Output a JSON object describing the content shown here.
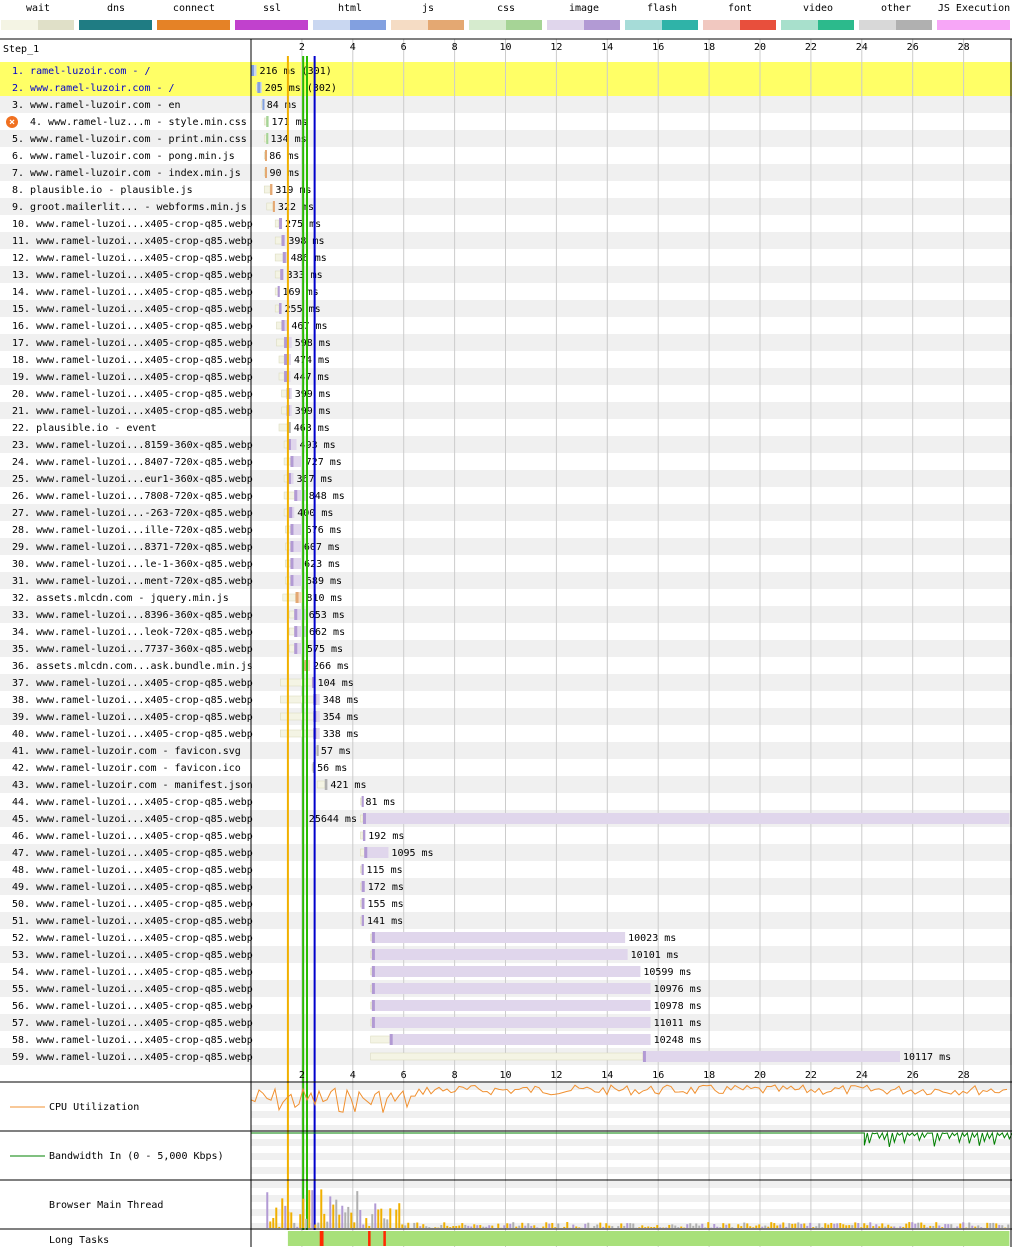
{
  "legend": [
    {
      "label": "wait",
      "light": "#f4f4e4",
      "dark": "#e0e0c8"
    },
    {
      "label": "dns",
      "light": "#1f7c83",
      "dark": "#1f7c83"
    },
    {
      "label": "connect",
      "light": "#e58226",
      "dark": "#e58226"
    },
    {
      "label": "ssl",
      "light": "#c141cd",
      "dark": "#c141cd"
    },
    {
      "label": "html",
      "light": "#c9d7f1",
      "dark": "#82a0e0"
    },
    {
      "label": "js",
      "light": "#f5dcc4",
      "dark": "#e4a872"
    },
    {
      "label": "css",
      "light": "#d6ebce",
      "dark": "#a6d496"
    },
    {
      "label": "image",
      "light": "#e0d6ec",
      "dark": "#b29ad4"
    },
    {
      "label": "flash",
      "light": "#a6dcd8",
      "dark": "#2fb3a8"
    },
    {
      "label": "font",
      "light": "#f1c8c0",
      "dark": "#e84f3c"
    },
    {
      "label": "video",
      "light": "#a8e0cc",
      "dark": "#2cba8c"
    },
    {
      "label": "other",
      "light": "#d8d8d8",
      "dark": "#b0b0b0"
    },
    {
      "label": "JS Execution",
      "light": "#f7a6f7",
      "dark": "#f7a6f7"
    }
  ],
  "step_label": "Step_1",
  "colors": {
    "highlight": "#ffff66",
    "row_alt": "#f0f0f0",
    "grid": "#cccccc",
    "start_render": "#28bc00",
    "first_paint": "#f0b000",
    "dom_content": "#0000cc",
    "cpu": "#f09030",
    "bandwidth": "#008000",
    "long_task": "#a8e07a",
    "long_task_red": "#ff2a00"
  },
  "chart_data": {
    "type": "waterfall",
    "x_unit": "s",
    "xlim": [
      0,
      29.8
    ],
    "tick_labels": [
      "2",
      "4",
      "6",
      "8",
      "10",
      "12",
      "14",
      "16",
      "18",
      "20",
      "22",
      "24",
      "26",
      "28"
    ],
    "tick_values": [
      2,
      4,
      6,
      8,
      10,
      12,
      14,
      16,
      18,
      20,
      22,
      24,
      26,
      28
    ],
    "markers": [
      {
        "name": "first_paint",
        "x": 1.45
      },
      {
        "name": "start_render_a",
        "x": 2.05
      },
      {
        "name": "start_render_b",
        "x": 2.2
      },
      {
        "name": "dom_content",
        "x": 2.5
      }
    ],
    "requests": [
      {
        "n": "1",
        "label": "ramel-luzoir.com - /",
        "start": 0.0,
        "wait": 0.0,
        "end": 0.216,
        "type": "html",
        "timing": "216 ms (301)",
        "highlight": true,
        "error": false
      },
      {
        "n": "2",
        "label": "www.ramel-luzoir.com - /",
        "start": 0.2,
        "wait": 0.25,
        "end": 0.42,
        "type": "html",
        "timing": "205 ms (302)",
        "highlight": true,
        "error": false
      },
      {
        "n": "3",
        "label": "www.ramel-luzoir.com - en",
        "start": 0.42,
        "wait": 0.45,
        "end": 0.5,
        "type": "html",
        "timing": "84 ms",
        "highlight": false,
        "error": false
      },
      {
        "n": "4",
        "label": "www.ramel-luz...m - style.min.css",
        "start": 0.52,
        "wait": 0.6,
        "end": 0.69,
        "type": "css",
        "timing": "171 ms",
        "highlight": false,
        "error": true
      },
      {
        "n": "5",
        "label": "www.ramel-luzoir.com - print.min.css",
        "start": 0.52,
        "wait": 0.6,
        "end": 0.65,
        "type": "css",
        "timing": "134 ms",
        "highlight": false,
        "error": false
      },
      {
        "n": "6",
        "label": "www.ramel-luzoir.com - pong.min.js",
        "start": 0.52,
        "wait": 0.55,
        "end": 0.6,
        "type": "js",
        "timing": "86 ms",
        "highlight": false,
        "error": false
      },
      {
        "n": "7",
        "label": "www.ramel-luzoir.com - index.min.js",
        "start": 0.52,
        "wait": 0.55,
        "end": 0.61,
        "type": "js",
        "timing": "90 ms",
        "highlight": false,
        "error": false
      },
      {
        "n": "8",
        "label": "plausible.io - plausible.js",
        "start": 0.52,
        "wait": 0.75,
        "end": 0.84,
        "type": "js",
        "timing": "319 ms",
        "highlight": false,
        "error": false
      },
      {
        "n": "9",
        "label": "groot.mailerlit... - webforms.min.js",
        "start": 0.62,
        "wait": 0.86,
        "end": 0.94,
        "type": "js",
        "timing": "322 ms",
        "highlight": false,
        "error": false
      },
      {
        "n": "10",
        "label": "www.ramel-luzoi...x405-crop-q85.webp",
        "start": 0.95,
        "wait": 1.1,
        "end": 1.22,
        "type": "image",
        "timing": "275 ms",
        "highlight": false,
        "error": false
      },
      {
        "n": "11",
        "label": "www.ramel-luzoi...x405-crop-q85.webp",
        "start": 0.95,
        "wait": 1.2,
        "end": 1.35,
        "type": "image",
        "timing": "398 ms",
        "highlight": false,
        "error": false
      },
      {
        "n": "12",
        "label": "www.ramel-luzoi...x405-crop-q85.webp",
        "start": 0.95,
        "wait": 1.25,
        "end": 1.44,
        "type": "image",
        "timing": "486 ms",
        "highlight": false,
        "error": false
      },
      {
        "n": "13",
        "label": "www.ramel-luzoi...x405-crop-q85.webp",
        "start": 0.95,
        "wait": 1.15,
        "end": 1.28,
        "type": "image",
        "timing": "333 ms",
        "highlight": false,
        "error": false
      },
      {
        "n": "14",
        "label": "www.ramel-luzoi...x405-crop-q85.webp",
        "start": 0.95,
        "wait": 1.05,
        "end": 1.12,
        "type": "image",
        "timing": "169 ms",
        "highlight": false,
        "error": false
      },
      {
        "n": "15",
        "label": "www.ramel-luzoi...x405-crop-q85.webp",
        "start": 0.95,
        "wait": 1.1,
        "end": 1.2,
        "type": "image",
        "timing": "255 ms",
        "highlight": false,
        "error": false
      },
      {
        "n": "16",
        "label": "www.ramel-luzoi...x405-crop-q85.webp",
        "start": 1.0,
        "wait": 1.2,
        "end": 1.47,
        "type": "image",
        "timing": "467 ms",
        "highlight": false,
        "error": false
      },
      {
        "n": "17",
        "label": "www.ramel-luzoi...x405-crop-q85.webp",
        "start": 1.0,
        "wait": 1.3,
        "end": 1.6,
        "type": "image",
        "timing": "598 ms",
        "highlight": false,
        "error": false
      },
      {
        "n": "18",
        "label": "www.ramel-luzoi...x405-crop-q85.webp",
        "start": 1.1,
        "wait": 1.3,
        "end": 1.57,
        "type": "image",
        "timing": "474 ms",
        "highlight": false,
        "error": false
      },
      {
        "n": "19",
        "label": "www.ramel-luzoi...x405-crop-q85.webp",
        "start": 1.1,
        "wait": 1.3,
        "end": 1.55,
        "type": "image",
        "timing": "447 ms",
        "highlight": false,
        "error": false
      },
      {
        "n": "20",
        "label": "www.ramel-luzoi...x405-crop-q85.webp",
        "start": 1.2,
        "wait": 1.4,
        "end": 1.6,
        "type": "image",
        "timing": "399 ms",
        "highlight": false,
        "error": false
      },
      {
        "n": "21",
        "label": "www.ramel-luzoi...x405-crop-q85.webp",
        "start": 1.2,
        "wait": 1.4,
        "end": 1.6,
        "type": "image",
        "timing": "399 ms",
        "highlight": false,
        "error": false
      },
      {
        "n": "22",
        "label": "plausible.io - event",
        "start": 1.1,
        "wait": 1.45,
        "end": 1.56,
        "type": "other",
        "timing": "463 ms",
        "highlight": false,
        "error": false
      },
      {
        "n": "23",
        "label": "www.ramel-luzoi...8159-360x-q85.webp",
        "start": 1.3,
        "wait": 1.45,
        "end": 1.79,
        "type": "image",
        "timing": "493 ms",
        "highlight": false,
        "error": false
      },
      {
        "n": "24",
        "label": "www.ramel-luzoi...8407-720x-q85.webp",
        "start": 1.3,
        "wait": 1.55,
        "end": 2.03,
        "type": "image",
        "timing": "727 ms",
        "highlight": false,
        "error": false
      },
      {
        "n": "25",
        "label": "www.ramel-luzoi...eur1-360x-q85.webp",
        "start": 1.3,
        "wait": 1.45,
        "end": 1.67,
        "type": "image",
        "timing": "367 ms",
        "highlight": false,
        "error": false
      },
      {
        "n": "26",
        "label": "www.ramel-luzoi...7808-720x-q85.webp",
        "start": 1.3,
        "wait": 1.7,
        "end": 2.15,
        "type": "image",
        "timing": "848 ms",
        "highlight": false,
        "error": false
      },
      {
        "n": "27",
        "label": "www.ramel-luzoi...-263-720x-q85.webp",
        "start": 1.3,
        "wait": 1.5,
        "end": 1.7,
        "type": "image",
        "timing": "400 ms",
        "highlight": false,
        "error": false
      },
      {
        "n": "28",
        "label": "www.ramel-luzoi...ille-720x-q85.webp",
        "start": 1.35,
        "wait": 1.55,
        "end": 2.03,
        "type": "image",
        "timing": "676 ms",
        "highlight": false,
        "error": false
      },
      {
        "n": "29",
        "label": "www.ramel-luzoi...8371-720x-q85.webp",
        "start": 1.35,
        "wait": 1.55,
        "end": 1.96,
        "type": "image",
        "timing": "607 ms",
        "highlight": false,
        "error": false
      },
      {
        "n": "30",
        "label": "www.ramel-luzoi...le-1-360x-q85.webp",
        "start": 1.35,
        "wait": 1.55,
        "end": 1.97,
        "type": "image",
        "timing": "623 ms",
        "highlight": false,
        "error": false
      },
      {
        "n": "31",
        "label": "www.ramel-luzoi...ment-720x-q85.webp",
        "start": 1.35,
        "wait": 1.55,
        "end": 2.04,
        "type": "image",
        "timing": "689 ms",
        "highlight": false,
        "error": false
      },
      {
        "n": "32",
        "label": "assets.mlcdn.com - jquery.min.js",
        "start": 1.25,
        "wait": 1.75,
        "end": 2.06,
        "type": "js",
        "timing": "810 ms",
        "highlight": false,
        "error": false
      },
      {
        "n": "33",
        "label": "www.ramel-luzoi...8396-360x-q85.webp",
        "start": 1.5,
        "wait": 1.7,
        "end": 2.15,
        "type": "image",
        "timing": "653 ms",
        "highlight": false,
        "error": false
      },
      {
        "n": "34",
        "label": "www.ramel-luzoi...leok-720x-q85.webp",
        "start": 1.5,
        "wait": 1.7,
        "end": 2.16,
        "type": "image",
        "timing": "662 ms",
        "highlight": false,
        "error": false
      },
      {
        "n": "35",
        "label": "www.ramel-luzoi...7737-360x-q85.webp",
        "start": 1.5,
        "wait": 1.7,
        "end": 2.08,
        "type": "image",
        "timing": "575 ms",
        "highlight": false,
        "error": false
      },
      {
        "n": "36",
        "label": "assets.mlcdn.com...ask.bundle.min.js",
        "start": 2.05,
        "wait": 2.1,
        "end": 2.32,
        "type": "js",
        "timing": "266 ms",
        "highlight": false,
        "error": false
      },
      {
        "n": "37",
        "label": "www.ramel-luzoi...x405-crop-q85.webp",
        "start": 1.15,
        "wait": 2.4,
        "end": 2.5,
        "type": "image",
        "timing": "104 ms",
        "highlight": false,
        "error": false
      },
      {
        "n": "38",
        "label": "www.ramel-luzoi...x405-crop-q85.webp",
        "start": 1.15,
        "wait": 2.45,
        "end": 2.7,
        "type": "image",
        "timing": "348 ms",
        "highlight": false,
        "error": false
      },
      {
        "n": "39",
        "label": "www.ramel-luzoi...x405-crop-q85.webp",
        "start": 1.15,
        "wait": 2.45,
        "end": 2.7,
        "type": "image",
        "timing": "354 ms",
        "highlight": false,
        "error": false
      },
      {
        "n": "40",
        "label": "www.ramel-luzoi...x405-crop-q85.webp",
        "start": 1.15,
        "wait": 2.45,
        "end": 2.7,
        "type": "image",
        "timing": "338 ms",
        "highlight": false,
        "error": false
      },
      {
        "n": "41",
        "label": "www.ramel-luzoir.com - favicon.svg",
        "start": 2.55,
        "wait": 2.58,
        "end": 2.63,
        "type": "other",
        "timing": "57 ms",
        "highlight": false,
        "error": false
      },
      {
        "n": "42",
        "label": "www.ramel-luzoir.com - favicon.ico",
        "start": 2.4,
        "wait": 2.43,
        "end": 2.48,
        "type": "other",
        "timing": "56 ms",
        "highlight": false,
        "error": false
      },
      {
        "n": "43",
        "label": "www.ramel-luzoir.com - manifest.json",
        "start": 2.6,
        "wait": 2.9,
        "end": 3.0,
        "type": "other",
        "timing": "421 ms",
        "highlight": false,
        "error": false
      },
      {
        "n": "44",
        "label": "www.ramel-luzoi...x405-crop-q85.webp",
        "start": 4.3,
        "wait": 4.35,
        "end": 4.38,
        "type": "image",
        "timing": "81 ms",
        "highlight": false,
        "error": false
      },
      {
        "n": "45",
        "label": "www.ramel-luzoi...x405-crop-q85.webp",
        "start": 4.3,
        "wait": 4.4,
        "end": 29.8,
        "type": "image",
        "timing": "25644 ms",
        "highlight": false,
        "error": false
      },
      {
        "n": "46",
        "label": "www.ramel-luzoi...x405-crop-q85.webp",
        "start": 4.3,
        "wait": 4.4,
        "end": 4.49,
        "type": "image",
        "timing": "192 ms",
        "highlight": false,
        "error": false
      },
      {
        "n": "47",
        "label": "www.ramel-luzoi...x405-crop-q85.webp",
        "start": 4.3,
        "wait": 4.45,
        "end": 5.4,
        "type": "image",
        "timing": "1095 ms",
        "highlight": false,
        "error": false
      },
      {
        "n": "48",
        "label": "www.ramel-luzoi...x405-crop-q85.webp",
        "start": 4.3,
        "wait": 4.35,
        "end": 4.42,
        "type": "image",
        "timing": "115 ms",
        "highlight": false,
        "error": false
      },
      {
        "n": "49",
        "label": "www.ramel-luzoi...x405-crop-q85.webp",
        "start": 4.3,
        "wait": 4.35,
        "end": 4.47,
        "type": "image",
        "timing": "172 ms",
        "highlight": false,
        "error": false
      },
      {
        "n": "50",
        "label": "www.ramel-luzoi...x405-crop-q85.webp",
        "start": 4.3,
        "wait": 4.35,
        "end": 4.46,
        "type": "image",
        "timing": "155 ms",
        "highlight": false,
        "error": false
      },
      {
        "n": "51",
        "label": "www.ramel-luzoi...x405-crop-q85.webp",
        "start": 4.3,
        "wait": 4.35,
        "end": 4.44,
        "type": "image",
        "timing": "141 ms",
        "highlight": false,
        "error": false
      },
      {
        "n": "52",
        "label": "www.ramel-luzoi...x405-crop-q85.webp",
        "start": 4.7,
        "wait": 4.75,
        "end": 14.7,
        "type": "image",
        "timing": "10023 ms",
        "highlight": false,
        "error": false
      },
      {
        "n": "53",
        "label": "www.ramel-luzoi...x405-crop-q85.webp",
        "start": 4.7,
        "wait": 4.75,
        "end": 14.8,
        "type": "image",
        "timing": "10101 ms",
        "highlight": false,
        "error": false
      },
      {
        "n": "54",
        "label": "www.ramel-luzoi...x405-crop-q85.webp",
        "start": 4.7,
        "wait": 4.75,
        "end": 15.3,
        "type": "image",
        "timing": "10599 ms",
        "highlight": false,
        "error": false
      },
      {
        "n": "55",
        "label": "www.ramel-luzoi...x405-crop-q85.webp",
        "start": 4.7,
        "wait": 4.75,
        "end": 15.7,
        "type": "image",
        "timing": "10976 ms",
        "highlight": false,
        "error": false
      },
      {
        "n": "56",
        "label": "www.ramel-luzoi...x405-crop-q85.webp",
        "start": 4.7,
        "wait": 4.75,
        "end": 15.7,
        "type": "image",
        "timing": "10978 ms",
        "highlight": false,
        "error": false
      },
      {
        "n": "57",
        "label": "www.ramel-luzoi...x405-crop-q85.webp",
        "start": 4.7,
        "wait": 4.75,
        "end": 15.7,
        "type": "image",
        "timing": "11011 ms",
        "highlight": false,
        "error": false
      },
      {
        "n": "58",
        "label": "www.ramel-luzoi...x405-crop-q85.webp",
        "start": 4.7,
        "wait": 5.45,
        "end": 15.7,
        "type": "image",
        "timing": "10248 ms",
        "highlight": false,
        "error": false
      },
      {
        "n": "59",
        "label": "www.ramel-luzoi...x405-crop-q85.webp",
        "start": 4.7,
        "wait": 15.4,
        "end": 25.5,
        "type": "image",
        "timing": "10117 ms",
        "highlight": false,
        "error": false
      }
    ],
    "cpu_label": "CPU Utilization",
    "bandwidth_label": "Bandwidth In (0 - 5,000 Kbps)",
    "main_thread_label": "Browser Main Thread",
    "long_tasks_label": "Long Tasks",
    "long_tasks": [
      {
        "start": 1.45,
        "end": 29.8,
        "kind": "ok"
      },
      {
        "start": 2.7,
        "end": 2.85,
        "kind": "red"
      },
      {
        "start": 4.6,
        "end": 4.7,
        "kind": "red"
      },
      {
        "start": 5.2,
        "end": 5.3,
        "kind": "red"
      }
    ]
  }
}
